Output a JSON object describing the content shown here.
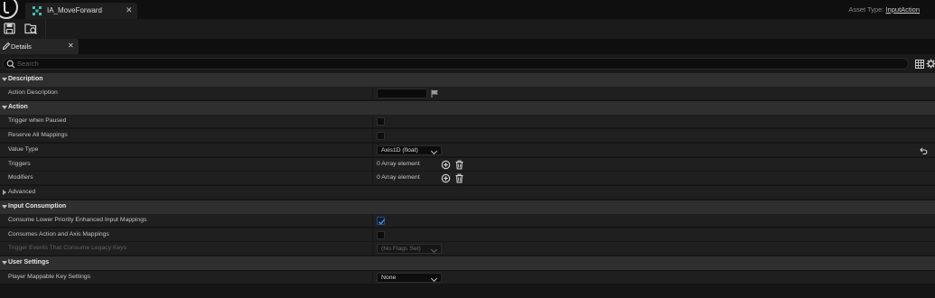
{
  "window": {
    "tab_title": "IA_MoveForward",
    "tab_close": "✕",
    "asset_type_label": "Asset Type:",
    "asset_type_value": "InputAction"
  },
  "toolbar": {
    "save_icon": "save-icon",
    "browse_icon": "browse-to-asset-icon"
  },
  "details_panel": {
    "tab_label": "Details",
    "tab_close": "✕",
    "search_placeholder": "Search"
  },
  "sections": {
    "description": {
      "title": "Description",
      "action_description": {
        "label": "Action Description",
        "value": ""
      }
    },
    "action": {
      "title": "Action",
      "trigger_when_paused": {
        "label": "Trigger when Paused",
        "checked": false
      },
      "reserve_all_mappings": {
        "label": "Reserve All Mappings",
        "checked": false
      },
      "value_type": {
        "label": "Value Type",
        "value": "Axis1D (float)"
      },
      "triggers": {
        "label": "Triggers",
        "value": "0 Array element"
      },
      "modifiers": {
        "label": "Modifiers",
        "value": "0 Array element"
      },
      "advanced": {
        "label": "Advanced"
      }
    },
    "input_consumption": {
      "title": "Input Consumption",
      "consume_lower_priority": {
        "label": "Consume Lower Priority Enhanced Input Mappings",
        "checked": true
      },
      "consumes_action_axis": {
        "label": "Consumes Action and Axis Mappings",
        "checked": false
      },
      "trigger_events_legacy": {
        "label": "Trigger Events That Consume Legacy Keys",
        "value": "(No Flags Set)"
      }
    },
    "user_settings": {
      "title": "User Settings",
      "player_mappable": {
        "label": "Player Mappable Key Settings",
        "value": "None"
      }
    }
  },
  "colors": {
    "accent_tab_icon": "#3fc1b0",
    "checkbox_check": "#4a8df0"
  }
}
